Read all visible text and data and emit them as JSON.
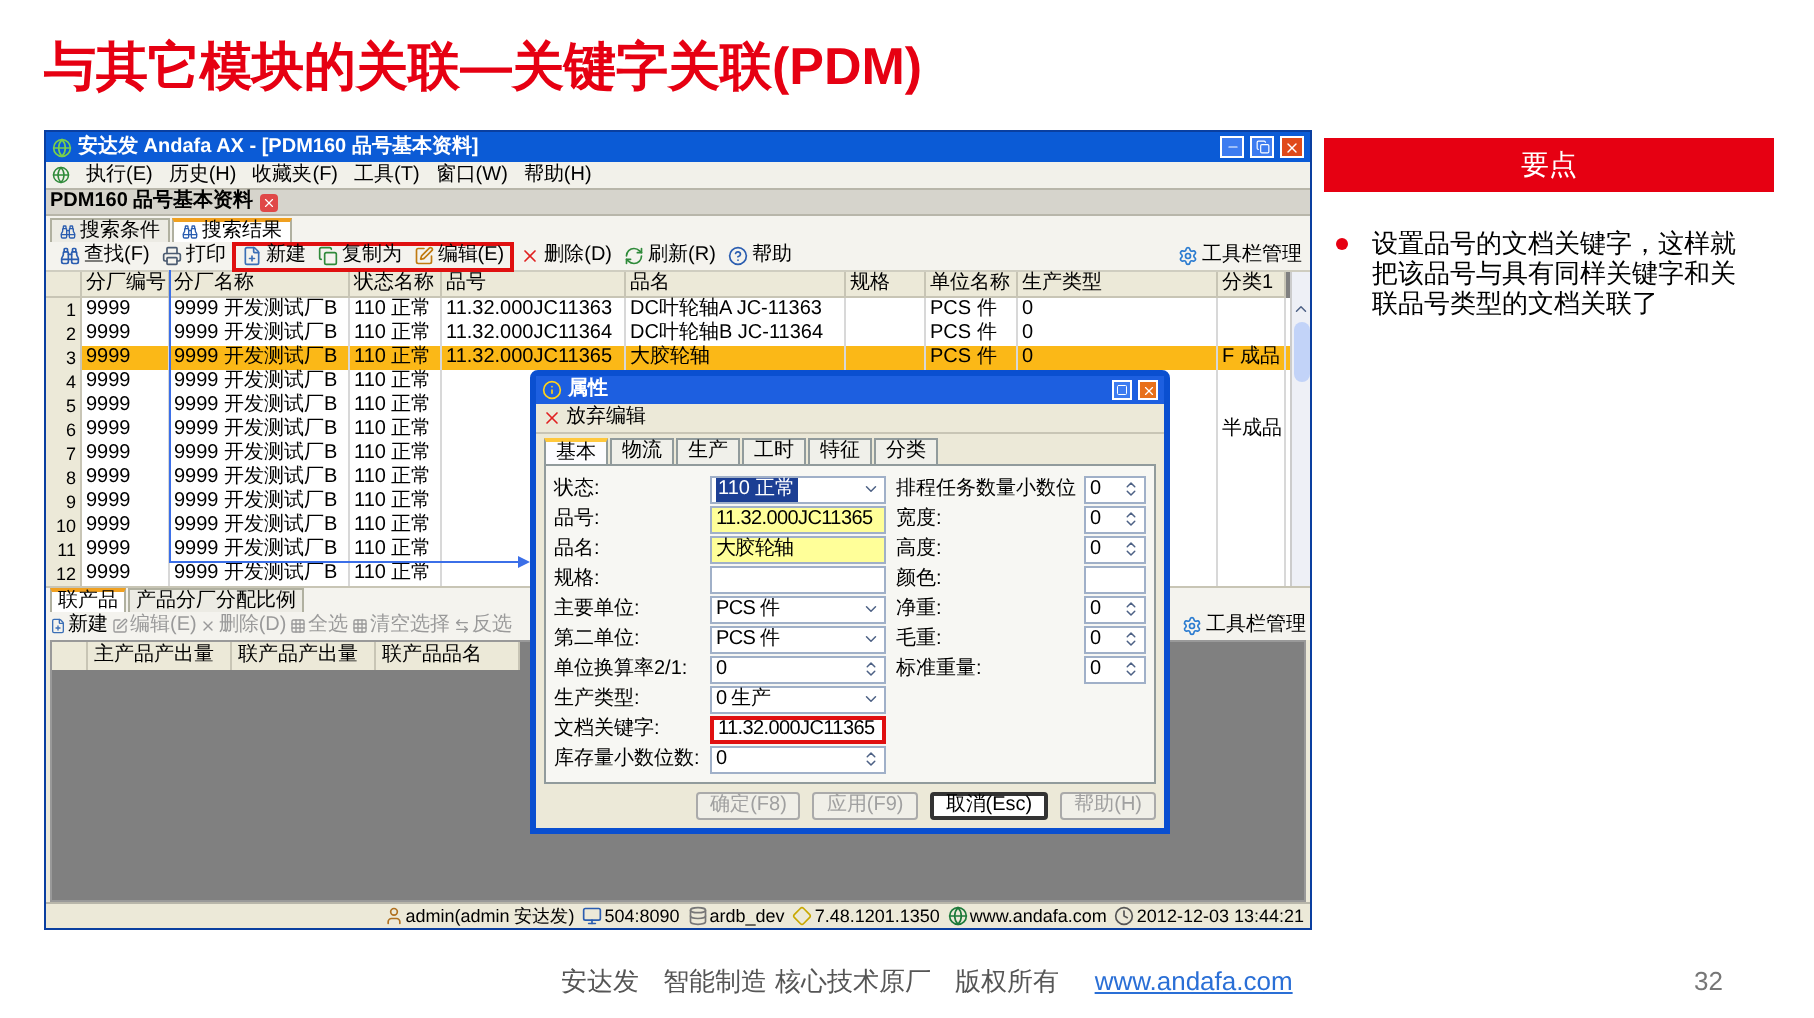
{
  "slide_title": "与其它模块的关联—关键字关联(PDM)",
  "app": {
    "window_title": "安达发 Andafa AX - [PDM160 品号基本资料]",
    "menu": [
      "执行(E)",
      "历史(H)",
      "收藏夹(F)",
      "工具(T)",
      "窗口(W)",
      "帮助(H)"
    ],
    "doc_tab": "PDM160 品号基本资料",
    "view_tabs": [
      {
        "label": "搜索条件",
        "selected": false
      },
      {
        "label": "搜索结果",
        "selected": true
      }
    ],
    "toolbar": [
      {
        "label": "查找(F)",
        "highlighted": false
      },
      {
        "label": "打印",
        "highlighted": false
      },
      {
        "label": "新建",
        "highlighted": true
      },
      {
        "label": "复制为",
        "highlighted": true
      },
      {
        "label": "编辑(E)",
        "highlighted": true
      },
      {
        "label": "删除(D)",
        "highlighted": false
      },
      {
        "label": "刷新(R)",
        "highlighted": false
      },
      {
        "label": "帮助",
        "highlighted": false
      }
    ],
    "toolbar_manager": "工具栏管理",
    "grid": {
      "columns": [
        "分厂编号",
        "分厂名称",
        "状态名称",
        "品号",
        "品名",
        "规格",
        "单位名称",
        "生产类型",
        "分类1"
      ],
      "rows": [
        {
          "num": "1",
          "factory_no": "9999",
          "factory_name": "9999 开发测试厂B",
          "status": "110 正常",
          "part_no": "11.32.000JC11363",
          "name": "DC叶轮轴A JC-11363",
          "unit": "PCS 件",
          "prod_type": "0",
          "selected": false
        },
        {
          "num": "2",
          "factory_no": "9999",
          "factory_name": "9999 开发测试厂B",
          "status": "110 正常",
          "part_no": "11.32.000JC11364",
          "name": "DC叶轮轴B JC-11364",
          "unit": "PCS 件",
          "prod_type": "0",
          "selected": false
        },
        {
          "num": "3",
          "factory_no": "9999",
          "factory_name": "9999 开发测试厂B",
          "status": "110 正常",
          "part_no": "11.32.000JC11365",
          "name": "大胶轮轴",
          "unit": "PCS 件",
          "prod_type": "0",
          "class1": "F 成品",
          "selected": true
        },
        {
          "num": "4",
          "factory_no": "9999",
          "factory_name": "9999 开发测试厂B",
          "status": "110 正常",
          "selected": false
        },
        {
          "num": "5",
          "factory_no": "9999",
          "factory_name": "9999 开发测试厂B",
          "status": "110 正常",
          "selected": false
        },
        {
          "num": "6",
          "factory_no": "9999",
          "factory_name": "9999 开发测试厂B",
          "status": "110 正常",
          "class1": "半成品",
          "selected": false
        },
        {
          "num": "7",
          "factory_no": "9999",
          "factory_name": "9999 开发测试厂B",
          "status": "110 正常",
          "selected": false
        },
        {
          "num": "8",
          "factory_no": "9999",
          "factory_name": "9999 开发测试厂B",
          "status": "110 正常",
          "selected": false
        },
        {
          "num": "9",
          "factory_no": "9999",
          "factory_name": "9999 开发测试厂B",
          "status": "110 正常",
          "selected": false
        },
        {
          "num": "10",
          "factory_no": "9999",
          "factory_name": "9999 开发测试厂B",
          "status": "110 正常",
          "selected": false
        },
        {
          "num": "11",
          "factory_no": "9999",
          "factory_name": "9999 开发测试厂B",
          "status": "110 正常",
          "selected": false
        },
        {
          "num": "12",
          "factory_no": "9999",
          "factory_name": "9999 开发测试厂B",
          "status": "110 正常",
          "selected": false
        }
      ]
    },
    "lower_tabs": [
      {
        "label": "联产品",
        "selected": true
      },
      {
        "label": "产品分厂分配比例",
        "selected": false
      }
    ],
    "lower_toolbar": [
      {
        "label": "新建",
        "disabled": false
      },
      {
        "label": "编辑(E)",
        "disabled": true
      },
      {
        "label": "删除(D)",
        "disabled": true
      },
      {
        "label": "全选",
        "disabled": true
      },
      {
        "label": "清空选择",
        "disabled": true
      },
      {
        "label": "反选",
        "disabled": true
      }
    ],
    "lower_toolbar_manager": "工具栏管理",
    "lower_columns": [
      "主产品产出量",
      "联产品产出量",
      "联产品品名"
    ],
    "status_bar": [
      "admin(admin 安达发)",
      "504:8090",
      "ardb_dev",
      "7.48.1201.1350",
      "www.andafa.com",
      "2012-12-03 13:44:21"
    ],
    "dialog": {
      "title": "属性",
      "discard": "放弃编辑",
      "tabs": [
        {
          "label": "基本",
          "selected": true
        },
        {
          "label": "物流",
          "selected": false
        },
        {
          "label": "生产",
          "selected": false
        },
        {
          "label": "工时",
          "selected": false
        },
        {
          "label": "特征",
          "selected": false
        },
        {
          "label": "分类",
          "selected": false
        }
      ],
      "left_fields": [
        {
          "label": "状态:",
          "value": "110 正常",
          "kind": "select",
          "focused": true
        },
        {
          "label": "品号:",
          "value": "11.32.000JC11365",
          "kind": "text",
          "required": true
        },
        {
          "label": "品名:",
          "value": "大胶轮轴",
          "kind": "text",
          "required": true
        },
        {
          "label": "规格:",
          "kind": "text"
        },
        {
          "label": "主要单位:",
          "value": "PCS 件",
          "kind": "select"
        },
        {
          "label": "第二单位:",
          "value": "PCS 件",
          "kind": "select"
        },
        {
          "label": "单位换算率2/1:",
          "value": "0",
          "kind": "spin"
        },
        {
          "label": "生产类型:",
          "value": "0 生产",
          "kind": "select"
        },
        {
          "label": "文档关键字:",
          "value": "11.32.000JC11365",
          "kind": "text",
          "highlighted": true
        },
        {
          "label": "库存量小数位数:",
          "value": "0",
          "kind": "spin"
        }
      ],
      "right_fields": [
        {
          "label": "排程任务数量小数位",
          "value": "0",
          "kind": "spin"
        },
        {
          "label": "宽度:",
          "value": "0",
          "kind": "spin"
        },
        {
          "label": "高度:",
          "value": "0",
          "kind": "spin"
        },
        {
          "label": "颜色:",
          "kind": "text"
        },
        {
          "label": "净重:",
          "value": "0",
          "kind": "spin"
        },
        {
          "label": "毛重:",
          "value": "0",
          "kind": "spin"
        },
        {
          "label": "标准重量:",
          "value": "0",
          "kind": "spin"
        }
      ],
      "buttons": [
        {
          "label": "确定(F8)",
          "disabled": true,
          "focused": false
        },
        {
          "label": "应用(F9)",
          "disabled": true,
          "focused": false
        },
        {
          "label": "取消(Esc)",
          "disabled": false,
          "focused": true
        },
        {
          "label": "帮助(H)",
          "disabled": true,
          "focused": false
        }
      ]
    }
  },
  "key_points": {
    "heading": "要点",
    "bullets": [
      "设置品号的文档关键字，这样就把该品号与具有同样关键字和关联品号类型的文档关联了"
    ]
  },
  "footer": {
    "company": "安达发",
    "slogan": "智能制造 核心技术原厂",
    "rights": "版权所有",
    "link": "www.andafa.com",
    "page": "32"
  }
}
